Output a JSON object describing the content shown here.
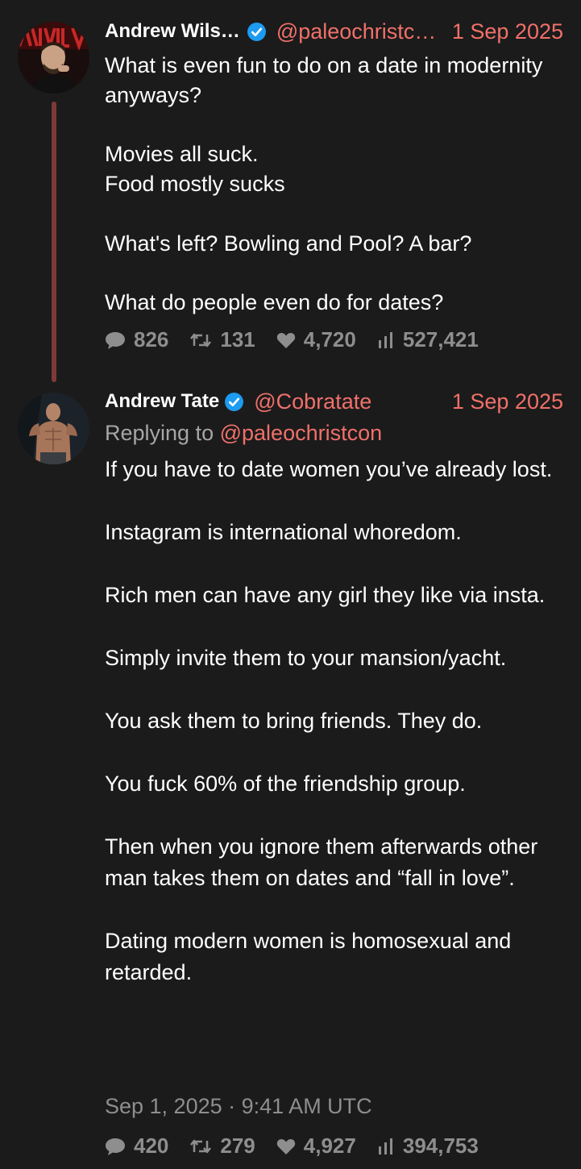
{
  "tweets": [
    {
      "author_name": "Andrew Wils…",
      "handle": "@paleochristc…",
      "date": "1 Sep 2025",
      "verified": true,
      "body": "What is even fun to do on a date in modernity anyways?\n\nMovies all suck.\nFood mostly sucks\n\nWhat's left? Bowling and Pool? A bar?\n\nWhat do people even do for dates?",
      "stats": {
        "replies": "826",
        "retweets": "131",
        "likes": "4,720",
        "views": "527,421"
      }
    },
    {
      "author_name": "Andrew Tate",
      "handle": "@Cobratate",
      "date": "1 Sep 2025",
      "verified": true,
      "replying_label": "Replying to",
      "replying_handle": "@paleochristcon",
      "body": "If you have to date women you’ve already lost.\n\nInstagram is international whoredom.\n\nRich men can have any girl they like via insta.\n\nSimply invite them to your mansion/yacht.\n\nYou ask them to bring friends. They do.\n\nYou fuck 60% of the friendship group.\n\nThen when you ignore them afterwards other man takes them on dates and “fall in love”.\n\nDating modern women is homosexual and retarded.",
      "timestamp": "Sep 1, 2025 · 9:41 AM UTC",
      "stats": {
        "replies": "420",
        "retweets": "279",
        "likes": "4,927",
        "views": "394,753"
      }
    }
  ],
  "colors": {
    "background": "#1b1b1b",
    "accent": "#f0706a",
    "muted": "#8e8e8e",
    "verified": "#1d9bf0",
    "thread_line": "#7d3a36"
  },
  "icons": [
    "comment-icon",
    "retweet-icon",
    "heart-icon",
    "views-icon",
    "verified-icon"
  ]
}
